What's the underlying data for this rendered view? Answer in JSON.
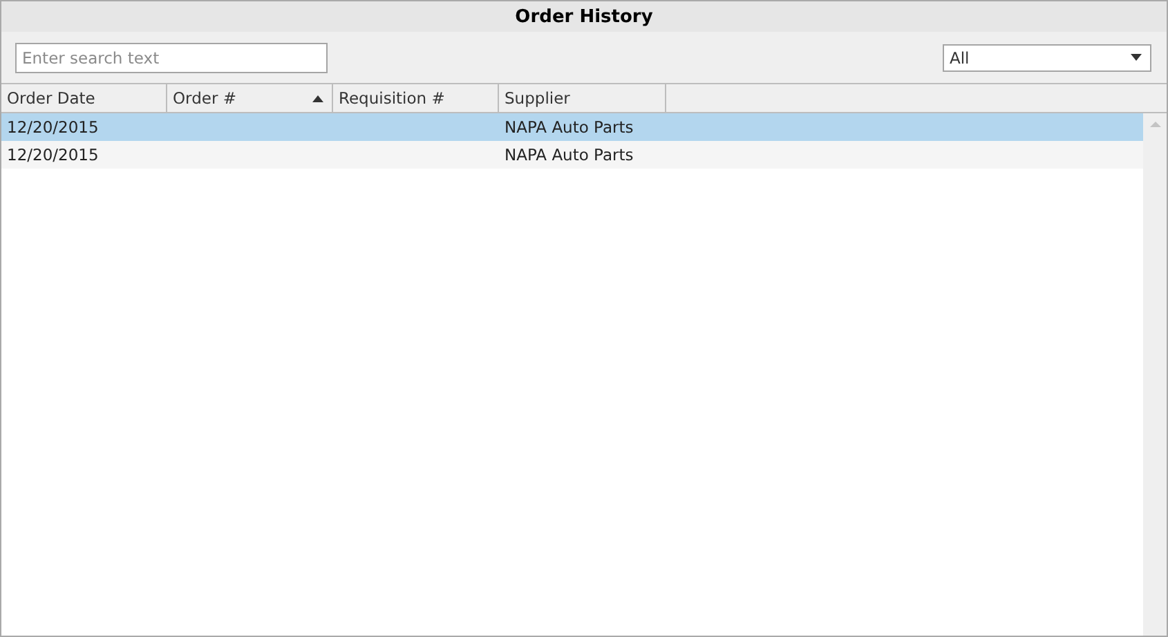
{
  "window": {
    "title": "Order History"
  },
  "search": {
    "placeholder": "Enter search text"
  },
  "filter": {
    "value": "All"
  },
  "table": {
    "columns": [
      {
        "label": "Order Date",
        "sorted": false
      },
      {
        "label": "Order #",
        "sorted": true
      },
      {
        "label": "Requisition #",
        "sorted": false
      },
      {
        "label": "Supplier",
        "sorted": false
      }
    ],
    "rows": [
      {
        "selected": true,
        "cells": [
          "12/20/2015",
          "",
          "",
          "NAPA Auto Parts"
        ]
      },
      {
        "selected": false,
        "cells": [
          "12/20/2015",
          "",
          "",
          "NAPA Auto Parts"
        ]
      }
    ]
  }
}
